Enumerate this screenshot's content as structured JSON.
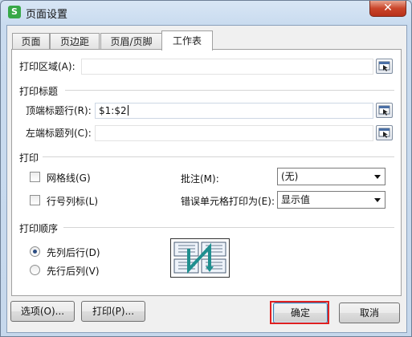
{
  "window": {
    "title": "页面设置",
    "app_icon_letter": "S",
    "close_glyph": "✕"
  },
  "tabs": [
    {
      "label": "页面"
    },
    {
      "label": "页边距"
    },
    {
      "label": "页眉/页脚"
    },
    {
      "label": "工作表"
    }
  ],
  "sheet": {
    "print_area": {
      "label": "打印区域(A):",
      "value": ""
    },
    "print_titles": {
      "section_label": "打印标题",
      "rows": {
        "label": "顶端标题行(R):",
        "value": "$1:$2"
      },
      "cols": {
        "label": "左端标题列(C):",
        "value": ""
      }
    },
    "print": {
      "section_label": "打印",
      "gridlines": {
        "label": "网格线(G)",
        "checked": false
      },
      "row_col_headings": {
        "label": "行号列标(L)",
        "checked": false
      },
      "comments": {
        "label": "批注(M):",
        "value": "(无)"
      },
      "cell_errors": {
        "label": "错误单元格打印为(E):",
        "value": "显示值"
      }
    },
    "page_order": {
      "section_label": "打印顺序",
      "down_then_over": {
        "label": "先列后行(D)",
        "selected": true
      },
      "over_then_down": {
        "label": "先行后列(V)",
        "selected": false
      }
    }
  },
  "buttons": {
    "options": "选项(O)...",
    "print": "打印(P)...",
    "ok": "确定",
    "cancel": "取消"
  },
  "colors": {
    "highlight_box": "#e02020",
    "arrow_teal": "#1f8f8f"
  }
}
